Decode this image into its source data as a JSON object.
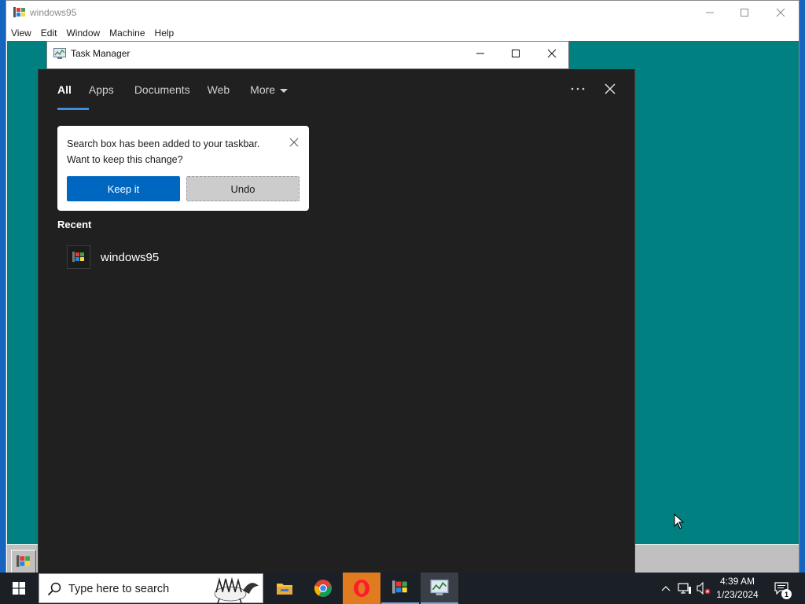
{
  "vm_window": {
    "title": "windows95",
    "menu": [
      "View",
      "Edit",
      "Window",
      "Machine",
      "Help"
    ]
  },
  "task_manager": {
    "title": "Task Manager"
  },
  "search_panel": {
    "tabs": [
      {
        "label": "All",
        "active": true
      },
      {
        "label": "Apps"
      },
      {
        "label": "Documents"
      },
      {
        "label": "Web"
      },
      {
        "label": "More",
        "dropdown": true
      }
    ],
    "popup": {
      "line1": "Search box has been added to your taskbar.",
      "line2": "Want to keep this change?",
      "keep_label": "Keep it",
      "undo_label": "Undo"
    },
    "recent_heading": "Recent",
    "recent_items": [
      {
        "label": "windows95",
        "icon": "windows95-icon"
      }
    ]
  },
  "taskbar": {
    "search_placeholder": "Type here to search",
    "apps": [
      "file-explorer-icon",
      "chrome-icon",
      "opera-icon",
      "windows95-icon",
      "task-manager-icon"
    ],
    "time": "4:39 AM",
    "date": "1/23/2024",
    "notification_count": "1"
  },
  "colors": {
    "vm_desktop": "#008080",
    "host_desktop": "#1565c0",
    "panel_bg": "#202020",
    "accent": "#0067c0",
    "tab_underline": "#3b8ee0",
    "taskbar_bg": "#1b1f26"
  }
}
